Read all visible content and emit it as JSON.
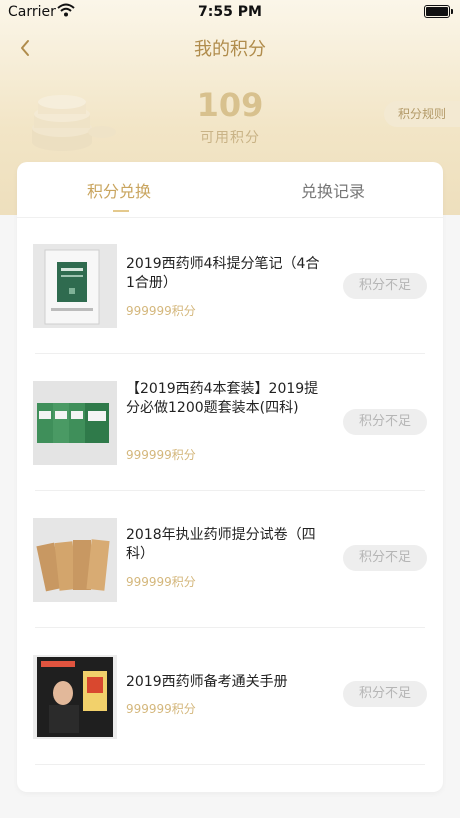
{
  "status_bar": {
    "carrier": "Carrier",
    "time": "7:55 PM"
  },
  "nav": {
    "title": "我的积分"
  },
  "points": {
    "value": "109",
    "label": "可用积分",
    "rules_label": "积分规则"
  },
  "tabs": [
    {
      "label": "积分兑换",
      "active": true
    },
    {
      "label": "兑换记录",
      "active": false
    }
  ],
  "items": [
    {
      "title": "2019西药师4科提分笔记（4合1合册）",
      "price": "999999积分",
      "button": "积分不足"
    },
    {
      "title": "【2019西药4本套装】2019提分必做1200题套装本(四科)",
      "price": "999999积分",
      "button": "积分不足"
    },
    {
      "title": "2018年执业药师提分试卷（四科）",
      "price": "999999积分",
      "button": "积分不足"
    },
    {
      "title": "2019西药师备考通关手册",
      "price": "999999积分",
      "button": "积分不足"
    }
  ],
  "colors": {
    "accent": "#c9a55f",
    "price": "#d4b77c",
    "hero_gold": "#eedfbd",
    "disabled_bg": "#eeeeee"
  }
}
